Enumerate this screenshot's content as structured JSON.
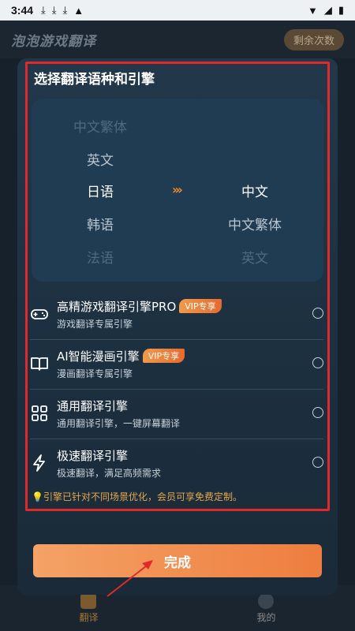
{
  "status": {
    "time": "3:44",
    "icons": [
      "download-icon",
      "download-icon",
      "download-icon",
      "app-icon"
    ],
    "right_icons": [
      "wifi-icon",
      "signal-icon",
      "battery-icon"
    ]
  },
  "app": {
    "title": "泡泡游戏翻译",
    "remaining_label": "剩余次数"
  },
  "nav": {
    "translate_label": "翻译",
    "mine_label": "我的",
    "accent": "#a8772f"
  },
  "modal": {
    "title": "选择翻译语种和引擎",
    "source_languages": [
      "中文繁体",
      "英文",
      "日语",
      "韩语",
      "法语"
    ],
    "target_languages": [
      "中文",
      "中文繁体",
      "英文"
    ],
    "source_selected": "日语",
    "target_selected": "中文",
    "arrow_glyph": "›››",
    "engines": [
      {
        "name": "高精游戏翻译引擎PRO",
        "desc": "游戏翻译专属引擎",
        "vip": "VIP专享",
        "icon": "gamepad-icon"
      },
      {
        "name": "AI智能漫画引擎",
        "desc": "漫画翻译专属引擎",
        "vip": "VIP专享",
        "icon": "book-icon"
      },
      {
        "name": "通用翻译引擎",
        "desc": "通用翻译引擎，一键屏幕翻译",
        "vip": "",
        "icon": "grid-icon"
      },
      {
        "name": "极速翻译引擎",
        "desc": "极速翻译，满足高频需求",
        "vip": "",
        "icon": "lightning-icon"
      }
    ],
    "hint": "引擎已针对不同场景优化，会员可享免费定制。",
    "done_label": "完成",
    "highlight_color": "#e0292b",
    "button_color": "#ee7d3f"
  }
}
